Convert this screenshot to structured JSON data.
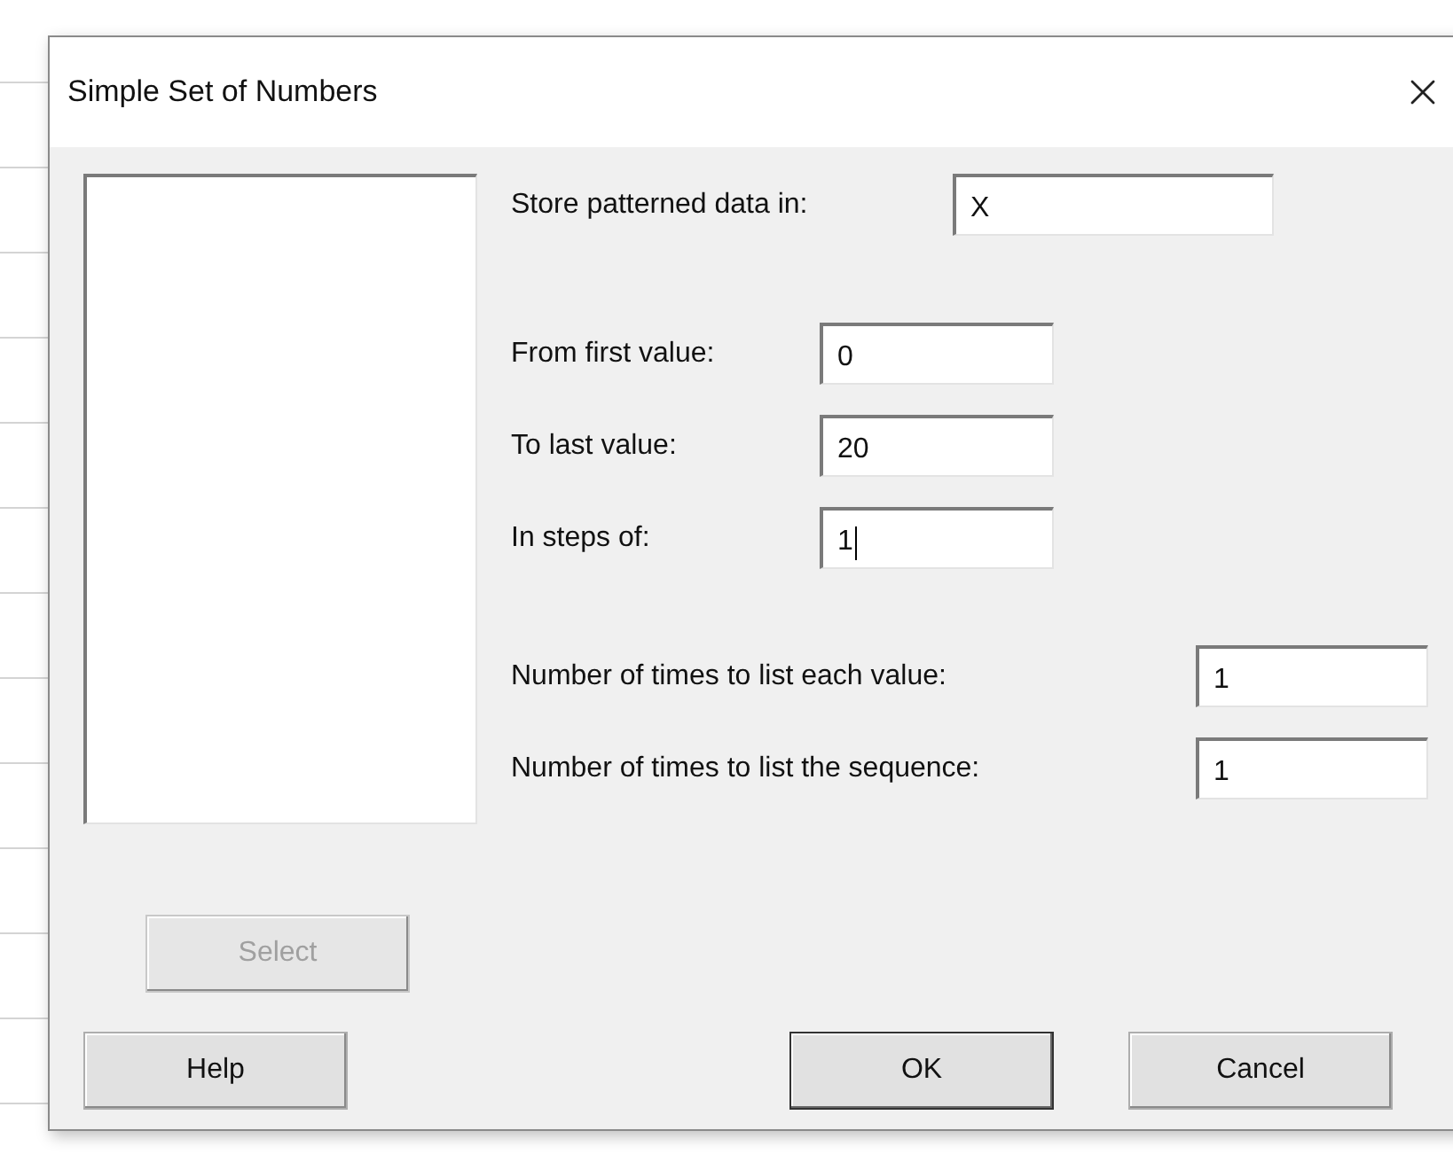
{
  "window": {
    "title": "Simple Set of Numbers"
  },
  "store_field": {
    "label": "Store patterned data in:",
    "value": "X",
    "focused": false
  },
  "range_fields": [
    {
      "label": "From first value:",
      "value": "0",
      "focused": false
    },
    {
      "label": "To last value:",
      "value": "20",
      "focused": false
    },
    {
      "label": "In steps of:",
      "value": "1",
      "focused": true
    }
  ],
  "repeat_fields": [
    {
      "label": "Number of times to list each value:",
      "value": "1",
      "focused": false
    },
    {
      "label": "Number of times to list the sequence:",
      "value": "1",
      "focused": false
    }
  ],
  "select_button": {
    "label": "Select",
    "disabled": true
  },
  "buttons": [
    {
      "label": "Help",
      "default": false
    },
    {
      "label": "OK",
      "default": true
    },
    {
      "label": "Cancel",
      "default": false
    }
  ]
}
